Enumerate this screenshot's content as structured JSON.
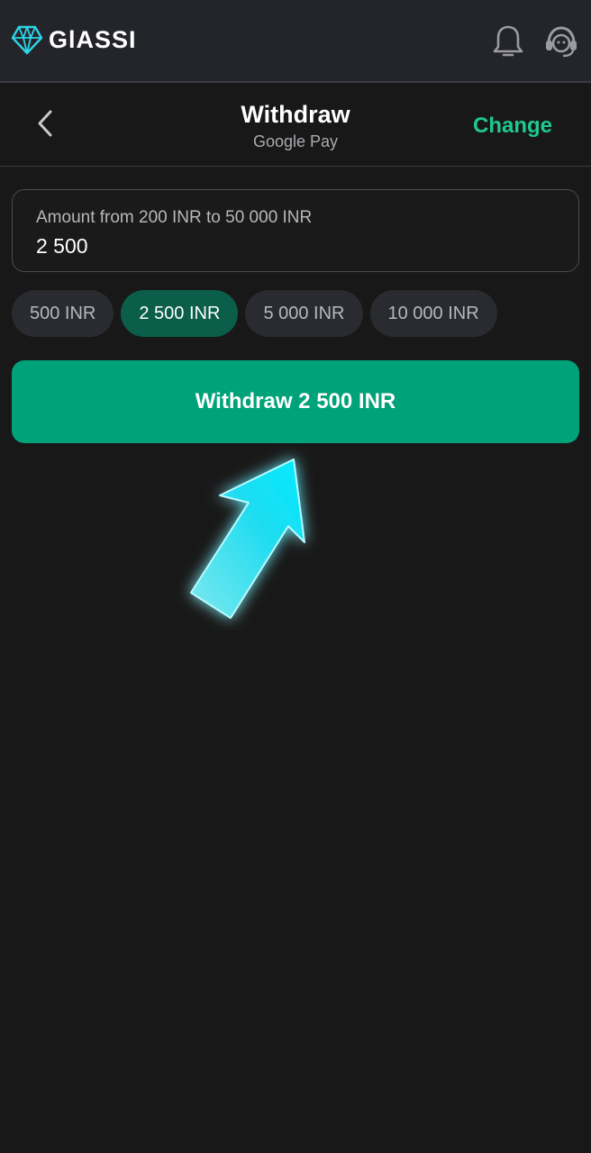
{
  "header": {
    "brand": "GlASSI",
    "icons": [
      "glassi-logo-icon",
      "bell-icon",
      "support-headset-icon"
    ]
  },
  "page": {
    "title": "Withdraw",
    "subtitle": "Google Pay",
    "change_label": "Change",
    "back_icon": "chevron-left-icon"
  },
  "amount": {
    "label": "Amount from 200 INR to 50 000 INR",
    "value": "2 500"
  },
  "presets": [
    {
      "label": "500 INR",
      "active": false
    },
    {
      "label": "2 500 INR",
      "active": true
    },
    {
      "label": "5 000 INR",
      "active": false
    },
    {
      "label": "10 000 INR",
      "active": false
    }
  ],
  "withdraw_button": {
    "label": "Withdraw 2 500 INR"
  },
  "colors": {
    "accent": "#00a27a",
    "accent_text": "#1fc990",
    "chip_active": "#0a5e4a",
    "arrow": "#22e0f0",
    "background": "#181818"
  }
}
